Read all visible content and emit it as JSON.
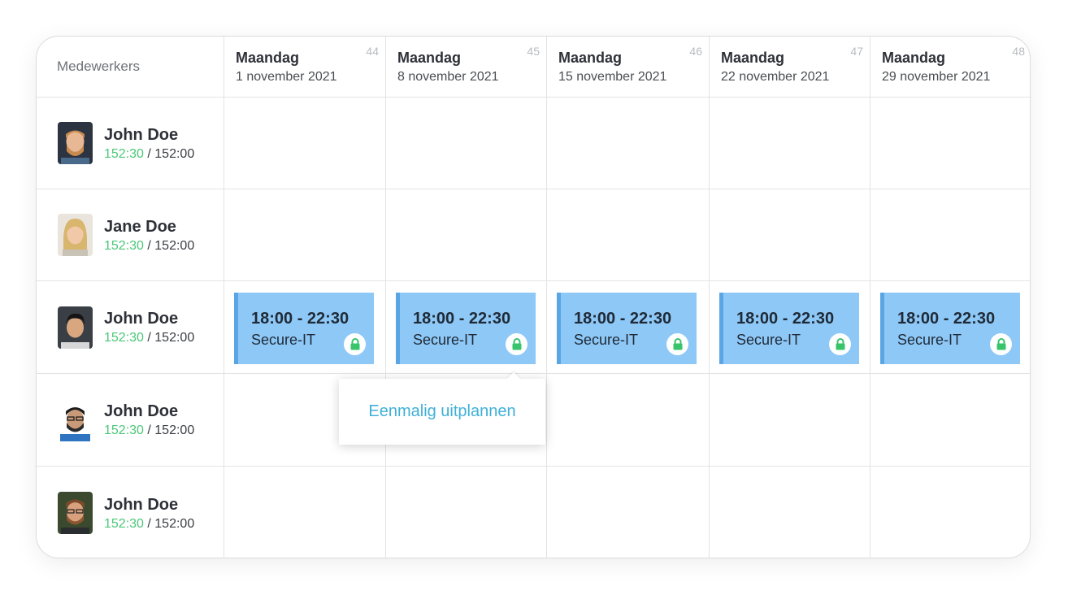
{
  "header": {
    "employees_label": "Medewerkers",
    "weeks": [
      {
        "day": "Maandag",
        "date": "1 november 2021",
        "week": "44"
      },
      {
        "day": "Maandag",
        "date": "8 november 2021",
        "week": "45"
      },
      {
        "day": "Maandag",
        "date": "15 november 2021",
        "week": "46"
      },
      {
        "day": "Maandag",
        "date": "22 november 2021",
        "week": "47"
      },
      {
        "day": "Maandag",
        "date": "29 november 2021",
        "week": "48"
      }
    ]
  },
  "employees": [
    {
      "name": "John Doe",
      "hours_done": "152:30",
      "hours_sep": " / ",
      "hours_total": "152:00"
    },
    {
      "name": "Jane Doe",
      "hours_done": "152:30",
      "hours_sep": " / ",
      "hours_total": "152:00"
    },
    {
      "name": "John Doe",
      "hours_done": "152:30",
      "hours_sep": " / ",
      "hours_total": "152:00"
    },
    {
      "name": "John Doe",
      "hours_done": "152:30",
      "hours_sep": " / ",
      "hours_total": "152:00"
    },
    {
      "name": "John Doe",
      "hours_done": "152:30",
      "hours_sep": " / ",
      "hours_total": "152:00"
    }
  ],
  "shift": {
    "time": "18:00 - 22:30",
    "client": "Secure-IT",
    "icon": "lock-icon"
  },
  "popup": {
    "action_label": "Eenmalig uitplannen"
  },
  "colors": {
    "shift_bg": "#8ec8f7",
    "shift_border": "#5aa6e4",
    "hours_done": "#4cc779",
    "lock": "#38c46a",
    "link": "#3fb0d8"
  }
}
